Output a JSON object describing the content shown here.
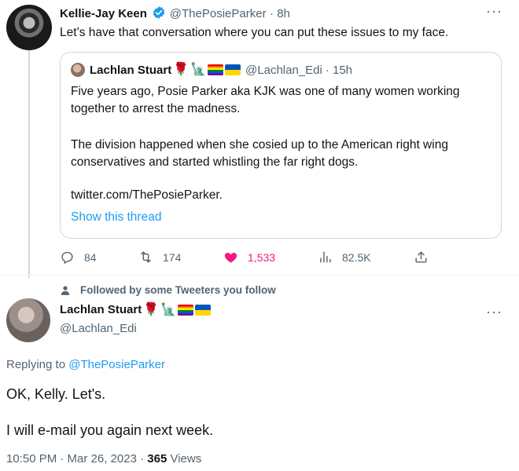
{
  "top_tweet": {
    "author_name": "Kellie-Jay Keen",
    "handle": "@ThePosieParker",
    "time": "· 8h",
    "text": "Let’s have that conversation where you can put these issues to my face.",
    "more": "···"
  },
  "quoted_tweet": {
    "author_name": "Lachlan Stuart",
    "handle": "@Lachlan_Edi",
    "time": "· 15h",
    "para1_line1": "Five years ago, Posie Parker aka KJK was one of many women working",
    "para1_line2": "together to arrest the madness.",
    "para2_line1": "The division happened when she cosied up to the American right wing",
    "para2_line2": "conservatives and started whistling the far right dogs.",
    "link_text": "twitter.com/ThePosieParker.",
    "show_thread": "Show this thread"
  },
  "actions": {
    "replies": "84",
    "retweets": "174",
    "likes": "1,533",
    "views": "82.5K"
  },
  "social_context": {
    "text": "Followed by some Tweeters you follow"
  },
  "main_tweet": {
    "author_name": "Lachlan Stuart",
    "handle": "@Lachlan_Edi",
    "more": "···",
    "replying_prefix": "Replying to ",
    "replying_to": "@ThePosieParker",
    "line1": "OK, Kelly. Let's.",
    "line2": "I will e-mail you again next week.",
    "timestamp": "10:50 PM · Mar 26, 2023 · ",
    "views_count": "365",
    "views_label": " Views"
  },
  "colors": {
    "accent": "#1d9bf0",
    "like": "#f91880",
    "muted": "#536471",
    "border": "#cfd9de"
  }
}
